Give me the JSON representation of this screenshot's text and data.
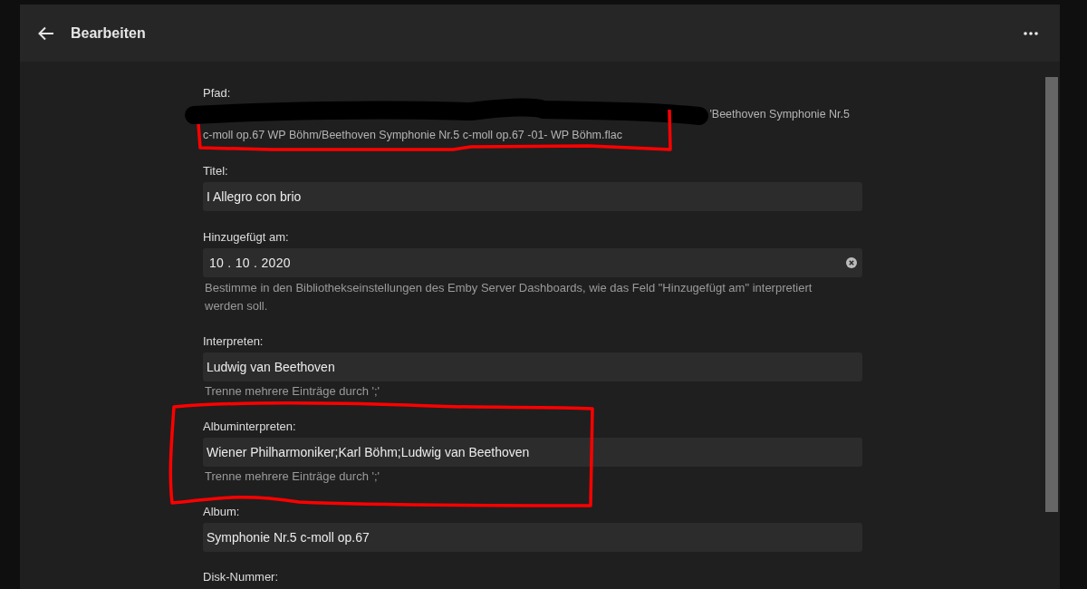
{
  "header": {
    "title": "Bearbeiten"
  },
  "fields": [
    {
      "kind": "path",
      "label": "Pfad:",
      "lines": [
        "'Beethoven Symphonie Nr.5",
        "c-moll op.67 WP Böhm/Beethoven Symphonie Nr.5 c-moll op.67 -01- WP Böhm.flac"
      ]
    },
    {
      "kind": "text",
      "label": "Titel:",
      "value": "I Allegro con brio"
    },
    {
      "kind": "date",
      "label": "Hinzugefügt am:",
      "value": "10 . 10 . 2020",
      "help": "Bestimme in den Bibliothekseinstellungen des Emby Server Dashboards, wie das Feld \"Hinzugefügt am\" interpretiert werden soll."
    },
    {
      "kind": "text",
      "label": "Interpreten:",
      "value": "Ludwig van Beethoven",
      "help": "Trenne mehrere Einträge durch ';'"
    },
    {
      "kind": "text",
      "label": "Albuminterpreten:",
      "value": "Wiener Philharmoniker;Karl Böhm;Ludwig van Beethoven",
      "help": "Trenne mehrere Einträge durch ';'"
    },
    {
      "kind": "text",
      "label": "Album:",
      "value": "Symphonie Nr.5 c-moll op.67"
    },
    {
      "kind": "label",
      "label": "Disk-Nummer:"
    }
  ],
  "annotations": [
    {
      "kind": "redaction"
    },
    {
      "kind": "outline"
    },
    {
      "kind": "outline"
    }
  ]
}
